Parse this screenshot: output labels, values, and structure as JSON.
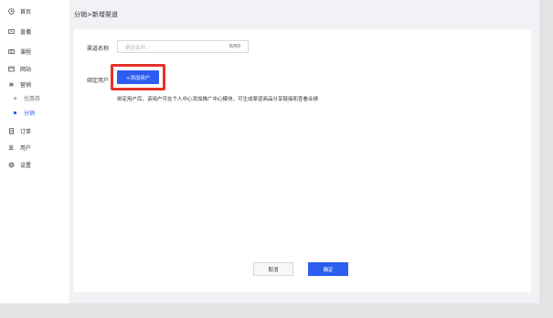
{
  "sidebar": {
    "items": [
      {
        "label": "首页",
        "icon": "clock-icon"
      },
      {
        "label": "直播",
        "icon": "live-icon"
      },
      {
        "label": "课程",
        "icon": "course-icon"
      },
      {
        "label": "网站",
        "icon": "website-icon"
      },
      {
        "label": "营销",
        "icon": "marketing-icon"
      },
      {
        "label": "优惠券",
        "icon": "dot-icon"
      },
      {
        "label": "分销",
        "icon": "square-icon"
      },
      {
        "label": "订单",
        "icon": "order-icon"
      },
      {
        "label": "用户",
        "icon": "user-icon"
      },
      {
        "label": "设置",
        "icon": "gear-icon"
      }
    ],
    "active_item": "分销"
  },
  "breadcrumb": "分销>新增渠道",
  "form": {
    "channel_name_label": "渠道名称",
    "channel_name_placeholder": "渠道名称",
    "channel_name_count": "0/60",
    "bind_user_label": "绑定用户",
    "add_user_button": "+添加用户",
    "hint": "绑定用户后，该用户可在个人中心添加推广中心模块，可生成渠道商品分享链接和查看业绩"
  },
  "footer": {
    "cancel": "取消",
    "confirm": "确定"
  },
  "colors": {
    "primary": "#2d5df0",
    "highlight": "#e8302a"
  }
}
